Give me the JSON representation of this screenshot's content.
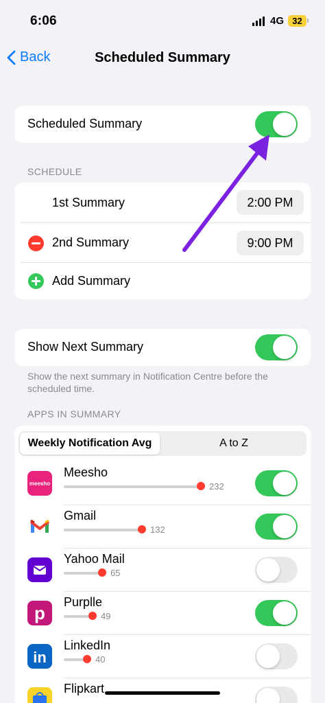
{
  "status_bar": {
    "time": "6:06",
    "network": "4G",
    "battery": "32"
  },
  "nav": {
    "back_label": "Back",
    "title": "Scheduled Summary"
  },
  "main_toggle": {
    "label": "Scheduled Summary",
    "on": true
  },
  "schedule": {
    "header": "SCHEDULE",
    "items": [
      {
        "label": "1st Summary",
        "time": "2:00 PM"
      },
      {
        "label": "2nd Summary",
        "time": "9:00 PM"
      }
    ],
    "add_label": "Add Summary"
  },
  "next_summary": {
    "label": "Show Next Summary",
    "on": true,
    "footnote": "Show the next summary in Notification Centre before the scheduled time."
  },
  "apps": {
    "header": "APPS IN SUMMARY",
    "tabs": [
      "Weekly Notification Avg",
      "A to Z"
    ],
    "active_tab": 0,
    "max_count": 232,
    "items": [
      {
        "name": "Meesho",
        "count": "232",
        "on": true,
        "icon": "meesho-icon",
        "icon_text": "meesho",
        "color": "#e9227d"
      },
      {
        "name": "Gmail",
        "count": "132",
        "on": true,
        "icon": "gmail-icon",
        "icon_text": "",
        "color": "#ffffff"
      },
      {
        "name": "Yahoo Mail",
        "count": "65",
        "on": false,
        "icon": "yahoo-mail-icon",
        "icon_text": "",
        "color": "#6001d2"
      },
      {
        "name": "Purplle",
        "count": "49",
        "on": true,
        "icon": "purplle-icon",
        "icon_text": "p",
        "color": "#c2187a"
      },
      {
        "name": "LinkedIn",
        "count": "40",
        "on": false,
        "icon": "linkedin-icon",
        "icon_text": "in",
        "color": "#0a66c2"
      },
      {
        "name": "Flipkart",
        "count": "",
        "on": false,
        "icon": "flipkart-icon",
        "icon_text": "",
        "color": "#f8d32a"
      }
    ]
  },
  "colors": {
    "accent": "#0a7aff",
    "toggle_on": "#34c759",
    "arrow": "#7b22e0",
    "dot": "#ff3b30"
  }
}
